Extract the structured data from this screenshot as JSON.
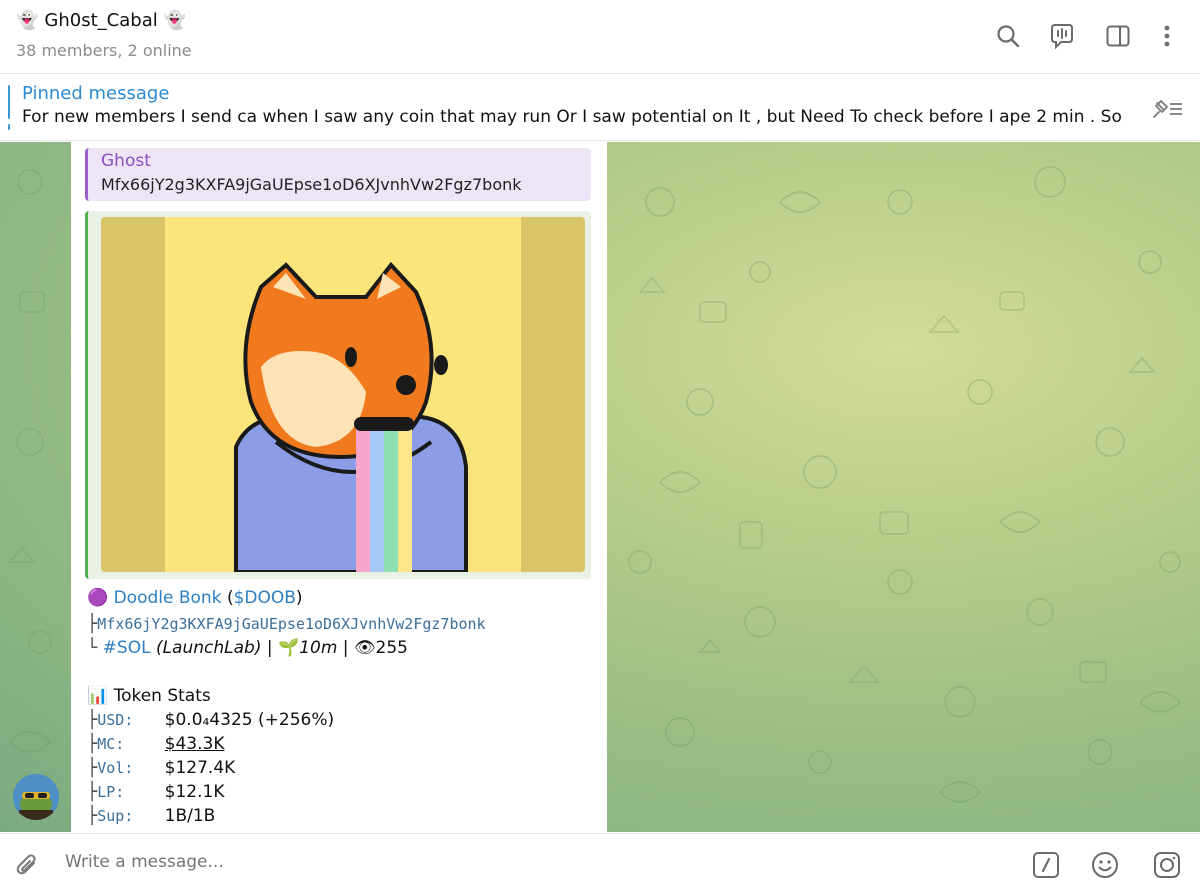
{
  "header": {
    "chat_title": "Gh0st_Cabal",
    "title_emoji": "👻",
    "members": "38 members, 2 online",
    "icons": [
      "search-icon",
      "voice-chat-icon",
      "sidebar-toggle-icon",
      "more-icon"
    ]
  },
  "pinned": {
    "label": "Pinned message",
    "text": "For new members I send ca when I saw any coin that may run Or I saw potential on It , but Need To check before I ape 2 min . So ..."
  },
  "reply": {
    "author": "Ghost",
    "text": "Mfx66jY2g3KXFA9jGaUEpse1oD6XJvnhVw2Fgz7bonk"
  },
  "message": {
    "token_emoji": "🟣",
    "token_name": "Doodle Bonk",
    "ticker_open": "(",
    "ticker": "$DOOB",
    "ticker_close": ")",
    "tree_branch": "├",
    "tree_end": "└",
    "contract": "Mfx66jY2g3KXFA9jGaUEpse1oD6XJvnhVw2Fgz7bonk",
    "chain_tag": "#SOL",
    "launchpad": "(LaunchLab)",
    "separator": "|",
    "age_emoji": "🌱",
    "age": "10m",
    "views_emoji": "👁",
    "views": "255",
    "stats_emoji": "📊",
    "stats_title": "Token Stats",
    "stats": [
      {
        "key": "USD:",
        "value": "$0.0₄4325",
        "extra": "(+256%)"
      },
      {
        "key": "MC:",
        "value": "$43.3K",
        "extra": ""
      },
      {
        "key": "Vol:",
        "value": "$127.4K",
        "extra": ""
      },
      {
        "key": "LP:",
        "value": "$12.1K",
        "extra": ""
      },
      {
        "key": "Sup:",
        "value": "1B/1B",
        "extra": ""
      }
    ]
  },
  "composer": {
    "placeholder": "Write a message...",
    "icons": [
      "attach-icon",
      "bot-commands-icon",
      "emoji-icon",
      "camera-icon"
    ]
  },
  "colors": {
    "accent": "#2c8bd0",
    "reply_accent": "#8b4fc0",
    "preview_accent": "#4fae4e"
  }
}
